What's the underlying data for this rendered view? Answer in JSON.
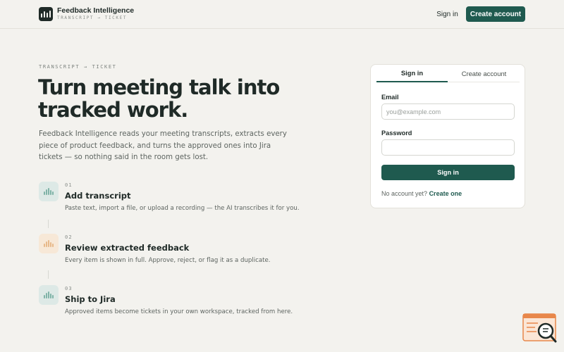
{
  "app": {
    "name": "Feedback Intelligence",
    "tagline": "TRANSCRIPT → TICKET"
  },
  "nav": {
    "sign_in": "Sign in",
    "create_account": "Create account"
  },
  "hero": {
    "eyebrow": "TRANSCRIPT → TICKET",
    "headline": "Turn meeting talk into tracked work.",
    "lede": "Feedback Intelligence reads your meeting transcripts, extracts every piece of product feedback, and turns the approved ones into Jira tickets — so nothing said in the room gets lost."
  },
  "steps": [
    {
      "num": "01",
      "title": "Add transcript",
      "desc": "Paste text, import a file, or upload a recording — the AI transcribes it for you.",
      "icon": "waveform-icon"
    },
    {
      "num": "02",
      "title": "Review extracted feedback",
      "desc": "Every item is shown in full. Approve, reject, or flag it as a duplicate.",
      "icon": "waveform-icon"
    },
    {
      "num": "03",
      "title": "Ship to Jira",
      "desc": "Approved items become tickets in your own workspace, tracked from here.",
      "icon": "waveform-icon"
    }
  ],
  "auth": {
    "tabs": [
      "Sign in",
      "Create account"
    ],
    "active_tab": "Sign in",
    "email_label": "Email",
    "email_placeholder": "you@example.com",
    "email_value": "",
    "password_label": "Password",
    "password_value": "",
    "submit_label": "Sign in",
    "footer_text": "No account yet?",
    "footer_link": "Create one"
  },
  "colors": {
    "accent": "#1f5a4f",
    "background": "#f3f2ee",
    "ink": "#1f2a27",
    "widget": "#e8874a"
  }
}
